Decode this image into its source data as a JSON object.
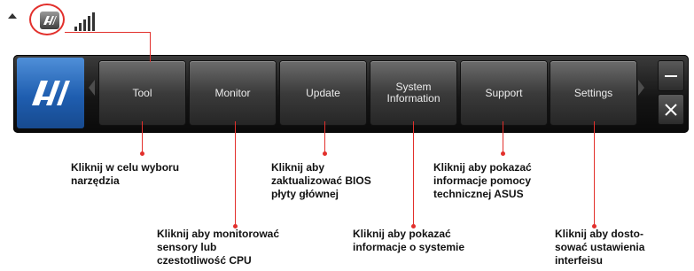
{
  "tray": {
    "icons": [
      "tray-expand-arrow-icon",
      "ai-suite-tray-icon",
      "network-signal-icon"
    ]
  },
  "toolbar": {
    "logo_icon": "ai-suite-logo-icon",
    "tabs": [
      {
        "label": "Tool"
      },
      {
        "label": "Monitor"
      },
      {
        "label": "Update"
      },
      {
        "label": "System\nInformation"
      },
      {
        "label": "Support"
      },
      {
        "label": "Settings"
      }
    ],
    "window_buttons": {
      "minimize": "minimize-icon",
      "close": "close-icon"
    }
  },
  "callouts": {
    "tool": "Kliknij w celu wyboru\nnarzędzia",
    "monitor": "Kliknij aby monitorować\nsensory lub\nczestotliwość CPU",
    "update": "Kliknij aby\nzaktualizować BIOS\npłyty głównej",
    "system_info": "Kliknij aby pokazać\ninformacje o systemie",
    "support": "Kliknij  aby pokazać\ninformacje pomocy\ntechnicznej ASUS",
    "settings": "Kliknij aby dosto-\nsować ustawienia\ninterfeisu"
  },
  "colors": {
    "accent_red": "#e2302c",
    "logo_blue": "#1f5eb0",
    "toolbar_dark": "#151515"
  }
}
